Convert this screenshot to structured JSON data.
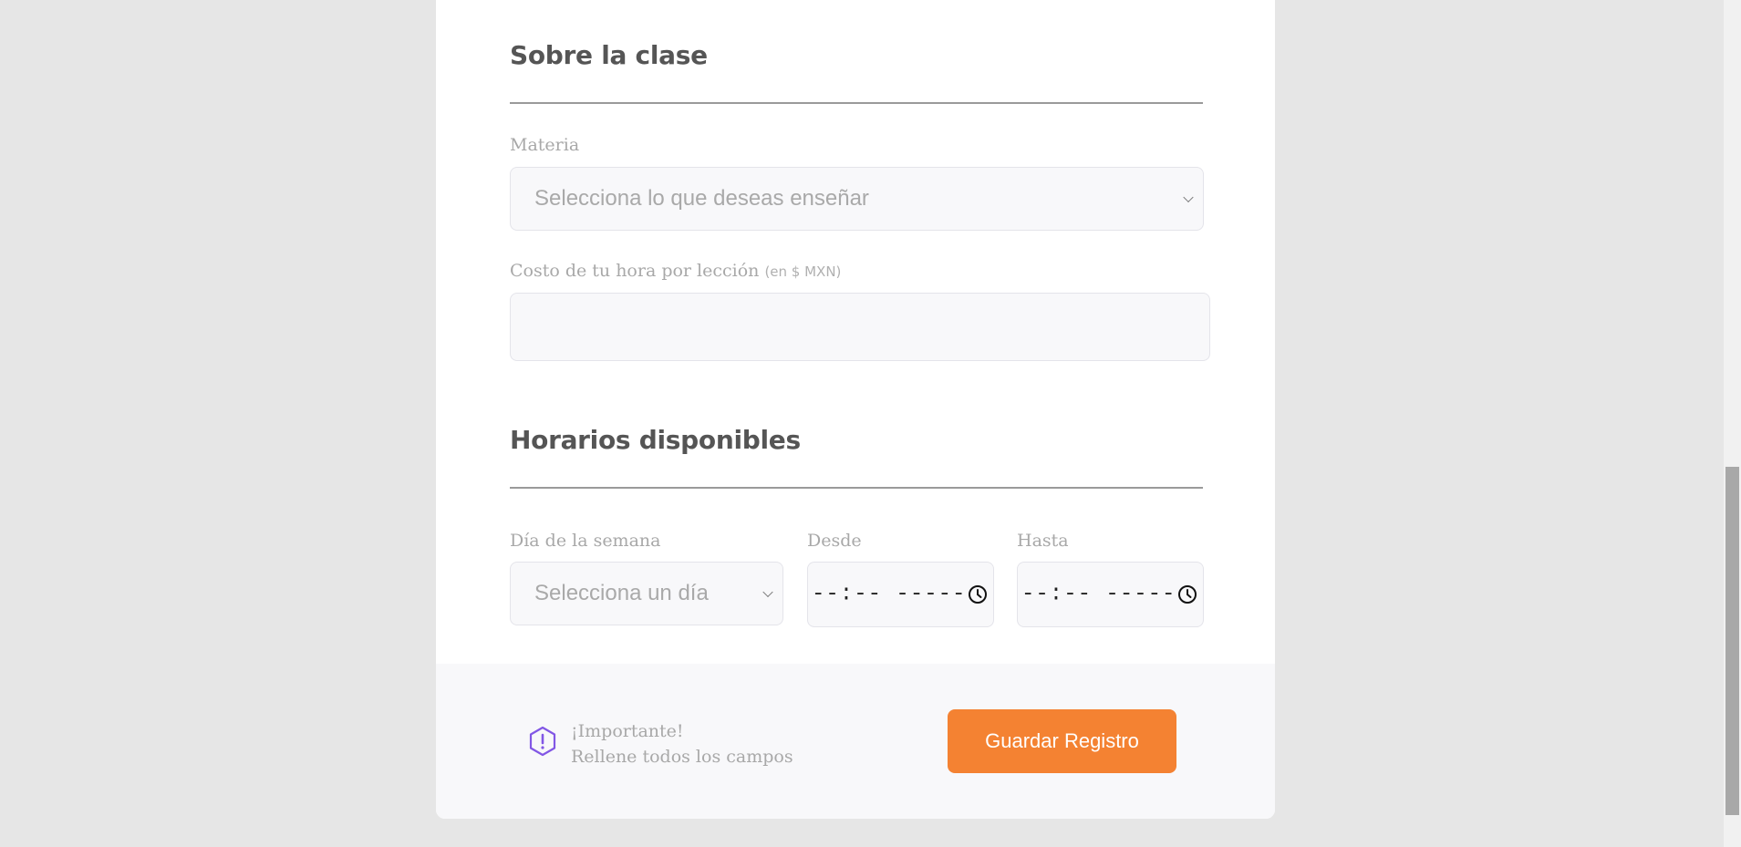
{
  "about_class": {
    "title": "Sobre la clase",
    "subject": {
      "label": "Materia",
      "placeholder": "Selecciona lo que deseas enseñar"
    },
    "cost": {
      "label": "Costo de tu hora por lección",
      "hint": "(en $ MXN)",
      "value": ""
    }
  },
  "schedule": {
    "title": "Horarios disponibles",
    "weekday": {
      "label": "Día de la semana",
      "placeholder": "Selecciona un día"
    },
    "from": {
      "label": "Desde",
      "value": "--:-- -----"
    },
    "to": {
      "label": "Hasta",
      "value": "--:-- -----"
    }
  },
  "footer": {
    "warning_title": "¡Importante!",
    "warning_text": "Rellene todos los campos",
    "save_label": "Guardar Registro",
    "accent_color": "#f48232",
    "warning_icon_color": "#8257e5"
  },
  "icons": {
    "select_arrow": "chevron-down-icon",
    "time_picker": "clock-icon",
    "warning": "warning-hexagon-icon"
  }
}
